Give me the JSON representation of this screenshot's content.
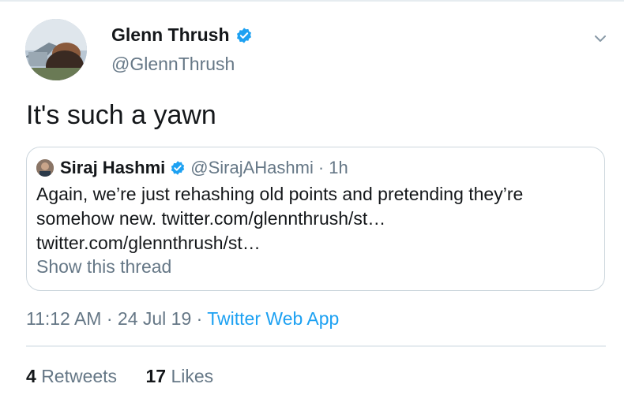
{
  "tweet": {
    "author": {
      "display_name": "Glenn Thrush",
      "handle": "@GlennThrush",
      "verified": true
    },
    "text": "It's such a yawn",
    "timestamp": "11:12 AM · 24 Jul 19 · ",
    "source": "Twitter Web App",
    "stats": {
      "retweets_count": "4",
      "retweets_label": "Retweets",
      "likes_count": "17",
      "likes_label": "Likes"
    }
  },
  "quoted_tweet": {
    "display_name": "Siraj Hashmi",
    "handle": "@SirajAHashmi",
    "separator": "·",
    "time": "1h",
    "text": "Again, we’re just rehashing old points and pretending they’re somehow new. twitter.com/glennthrush/st… twitter.com/glennthrush/st…",
    "show_thread": "Show this thread"
  },
  "colors": {
    "accent": "#1da1f2",
    "secondary_text": "#657786",
    "primary_text": "#14171a",
    "border": "#ccd6dd"
  },
  "icons": [
    "verified-badge-icon",
    "chevron-down-icon"
  ]
}
